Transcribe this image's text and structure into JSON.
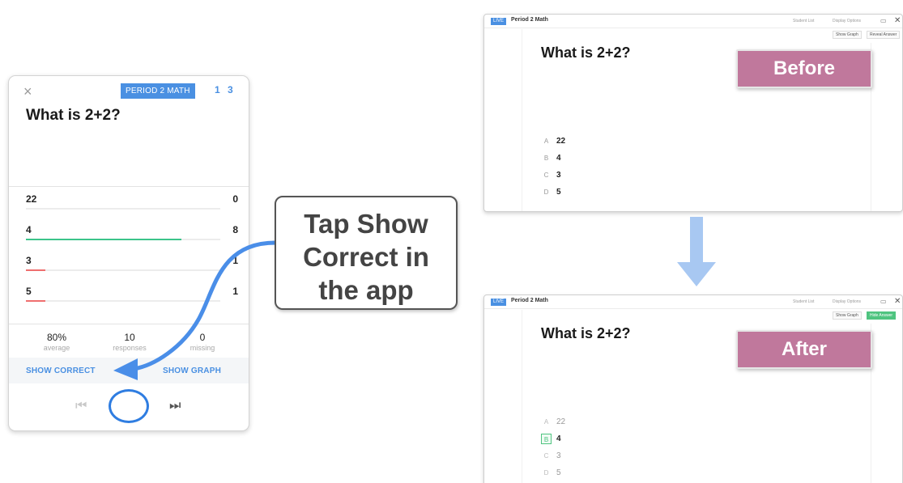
{
  "phone": {
    "close_glyph": "×",
    "class_badge": "PERIOD 2 MATH",
    "question_nav": "1 3",
    "question": "What is 2+2?",
    "answers": [
      {
        "label": "22",
        "count": "0",
        "fraction": 0.0,
        "color": ""
      },
      {
        "label": "4",
        "count": "8",
        "fraction": 0.8,
        "color": "#3cc48a"
      },
      {
        "label": "3",
        "count": "1",
        "fraction": 0.1,
        "color": "#ef6f6f"
      },
      {
        "label": "5",
        "count": "1",
        "fraction": 0.1,
        "color": "#ef6f6f"
      }
    ],
    "stats": [
      {
        "value": "80%",
        "label": "average"
      },
      {
        "value": "10",
        "label": "responses"
      },
      {
        "value": "0",
        "label": "missing"
      }
    ],
    "show_correct": "SHOW CORRECT",
    "show_graph": "SHOW GRAPH",
    "prev_glyph": "⏮",
    "next_glyph": "⏭",
    "accent_color": "#4a90e2"
  },
  "callout": {
    "line1": "Tap Show",
    "line2": "Correct in",
    "line3": "the app"
  },
  "window_before": {
    "live_badge": "LIVE",
    "title": "Period 2 Math",
    "student_list": "Student List",
    "display_options": "Display Options",
    "show_graph": "Show Graph",
    "reveal_answer": "Reveal Answer",
    "question": "What is 2+2?",
    "tag": "Before",
    "options": [
      {
        "letter": "A",
        "text": "22"
      },
      {
        "letter": "B",
        "text": "4"
      },
      {
        "letter": "C",
        "text": "3"
      },
      {
        "letter": "D",
        "text": "5"
      }
    ]
  },
  "window_after": {
    "live_badge": "LIVE",
    "title": "Period 2 Math",
    "student_list": "Student List",
    "display_options": "Display Options",
    "show_graph": "Show Graph",
    "hide_answer": "Hide Answer",
    "question": "What is 2+2?",
    "tag": "After",
    "options": [
      {
        "letter": "A",
        "text": "22"
      },
      {
        "letter": "B",
        "text": "4"
      },
      {
        "letter": "C",
        "text": "3"
      },
      {
        "letter": "D",
        "text": "5"
      }
    ]
  },
  "colors": {
    "tag_pink": "#c0789c",
    "arrow_blue": "#4a8ee8",
    "down_arrow": "#a8c8f2",
    "correct_green": "#4fc480"
  }
}
